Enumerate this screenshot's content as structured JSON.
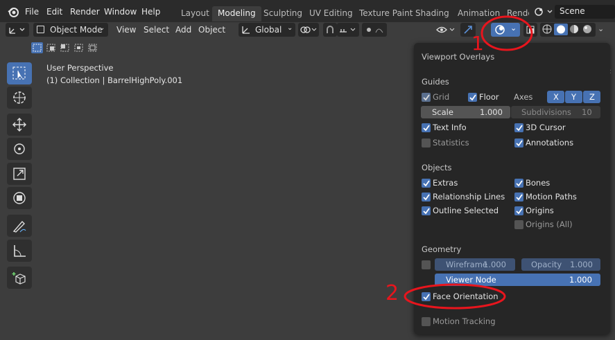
{
  "menu": {
    "file": "File",
    "edit": "Edit",
    "render": "Render",
    "window": "Window",
    "help": "Help"
  },
  "workspaces": [
    "Layout",
    "Modeling",
    "Sculpting",
    "UV Editing",
    "Texture Paint",
    "Shading",
    "Animation",
    "Rende"
  ],
  "scene": {
    "label": "Scene"
  },
  "header": {
    "mode": "Object Mode",
    "view": "View",
    "select": "Select",
    "add": "Add",
    "object": "Object",
    "orientation": "Global"
  },
  "viewport": {
    "perspective": "User Perspective",
    "collection": "(1) Collection | BarrelHighPoly.001"
  },
  "overlays": {
    "title": "Viewport Overlays",
    "guides": {
      "heading": "Guides",
      "grid": "Grid",
      "floor": "Floor",
      "axes": "Axes",
      "x": "X",
      "y": "Y",
      "z": "Z",
      "scale_label": "Scale",
      "scale_value": "1.000",
      "subdiv_label": "Subdivisions",
      "subdiv_value": "10",
      "text_info": "Text Info",
      "cursor": "3D Cursor",
      "statistics": "Statistics",
      "annotations": "Annotations"
    },
    "objects": {
      "heading": "Objects",
      "extras": "Extras",
      "bones": "Bones",
      "relationship": "Relationship Lines",
      "motion_paths": "Motion Paths",
      "outline": "Outline Selected",
      "origins": "Origins",
      "origins_all": "Origins (All)"
    },
    "geometry": {
      "heading": "Geometry",
      "wireframe_label": "Wireframe",
      "wireframe_value": "1.000",
      "opacity_label": "Opacity",
      "opacity_value": "1.000",
      "viewer_label": "Viewer Node",
      "viewer_value": "1.000",
      "face_orientation": "Face Orientation",
      "motion_tracking": "Motion Tracking"
    }
  },
  "annotations": {
    "marker1": "1",
    "marker2": "2"
  },
  "colors": {
    "accent": "#4772b3",
    "annotation": "#e8151d",
    "panel": "#262626",
    "viewport": "#3d3d3d"
  }
}
